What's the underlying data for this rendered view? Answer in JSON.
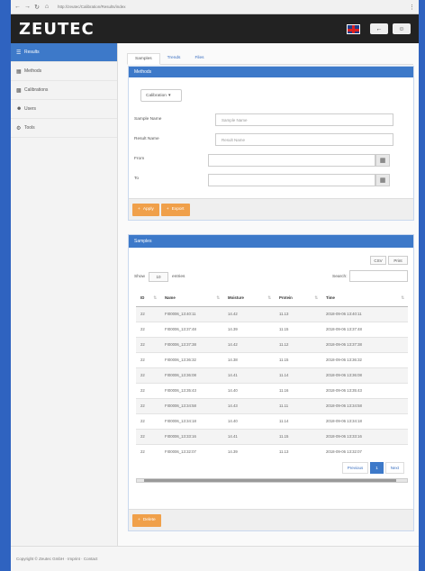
{
  "browser": {
    "url": "http://zeutec/Calibration/Results/index"
  },
  "header": {
    "logo": "ZEUTEC"
  },
  "sidebar": {
    "items": [
      {
        "label": "Results",
        "icon": "list-icon"
      },
      {
        "label": "Methods",
        "icon": "grid-icon"
      },
      {
        "label": "Calibrations",
        "icon": "chart-icon"
      },
      {
        "label": "Users",
        "icon": "user-icon"
      },
      {
        "label": "Tools",
        "icon": "gear-icon"
      }
    ]
  },
  "tabs": [
    "Samples",
    "Trends",
    "Files"
  ],
  "filter": {
    "title": "Methods",
    "dropdown": "Calibration",
    "sample_name_label": "Sample Name",
    "sample_name_placeholder": "Sample Name",
    "result_name_label": "Result Name",
    "result_name_placeholder": "Result Name",
    "from_label": "From",
    "to_label": "To",
    "apply_label": "Apply",
    "export_label": "Export"
  },
  "samples": {
    "title": "Samples",
    "csv_label": "CSV",
    "print_label": "Print",
    "show_label": "Show",
    "entries_value": "10",
    "entries_label": "entries",
    "search_label": "Search:",
    "columns": [
      "ID",
      "Name",
      "Moisture",
      "Protein",
      "Time"
    ],
    "rows": [
      [
        "22",
        "FI00006_13:40:11",
        "14.42",
        "11.13",
        "2018-09-06 13:40:11"
      ],
      [
        "22",
        "FI00006_13:37:48",
        "14.39",
        "11.15",
        "2018-09-06 13:37:48"
      ],
      [
        "22",
        "FI00006_13:37:38",
        "14.42",
        "11.12",
        "2018-09-06 13:37:38"
      ],
      [
        "22",
        "FI00006_13:36:32",
        "14.38",
        "11.15",
        "2018-09-06 13:36:32"
      ],
      [
        "22",
        "FI00006_13:36:08",
        "14.41",
        "11.14",
        "2018-09-06 13:36:08"
      ],
      [
        "22",
        "FI00006_13:35:43",
        "14.40",
        "11.16",
        "2018-09-06 13:35:43"
      ],
      [
        "22",
        "FI00006_13:34:58",
        "14.43",
        "11.11",
        "2018-09-06 13:34:58"
      ],
      [
        "22",
        "FI00006_13:34:18",
        "14.40",
        "11.14",
        "2018-09-06 13:34:18"
      ],
      [
        "22",
        "FI00006_13:33:16",
        "14.41",
        "11.15",
        "2018-09-06 13:33:16"
      ],
      [
        "22",
        "FI00006_13:32:07",
        "14.39",
        "11.13",
        "2018-09-06 13:32:07"
      ]
    ],
    "pager": {
      "previous": "Previous",
      "page": "1",
      "next": "Next"
    },
    "delete_label": "Delete"
  },
  "footer": {
    "text": "Copyright © Zeutec GmbH · Imprint · Contact"
  },
  "colors": {
    "accent": "#3d79c9",
    "action": "#f0a04a",
    "topbar": "#222222"
  }
}
